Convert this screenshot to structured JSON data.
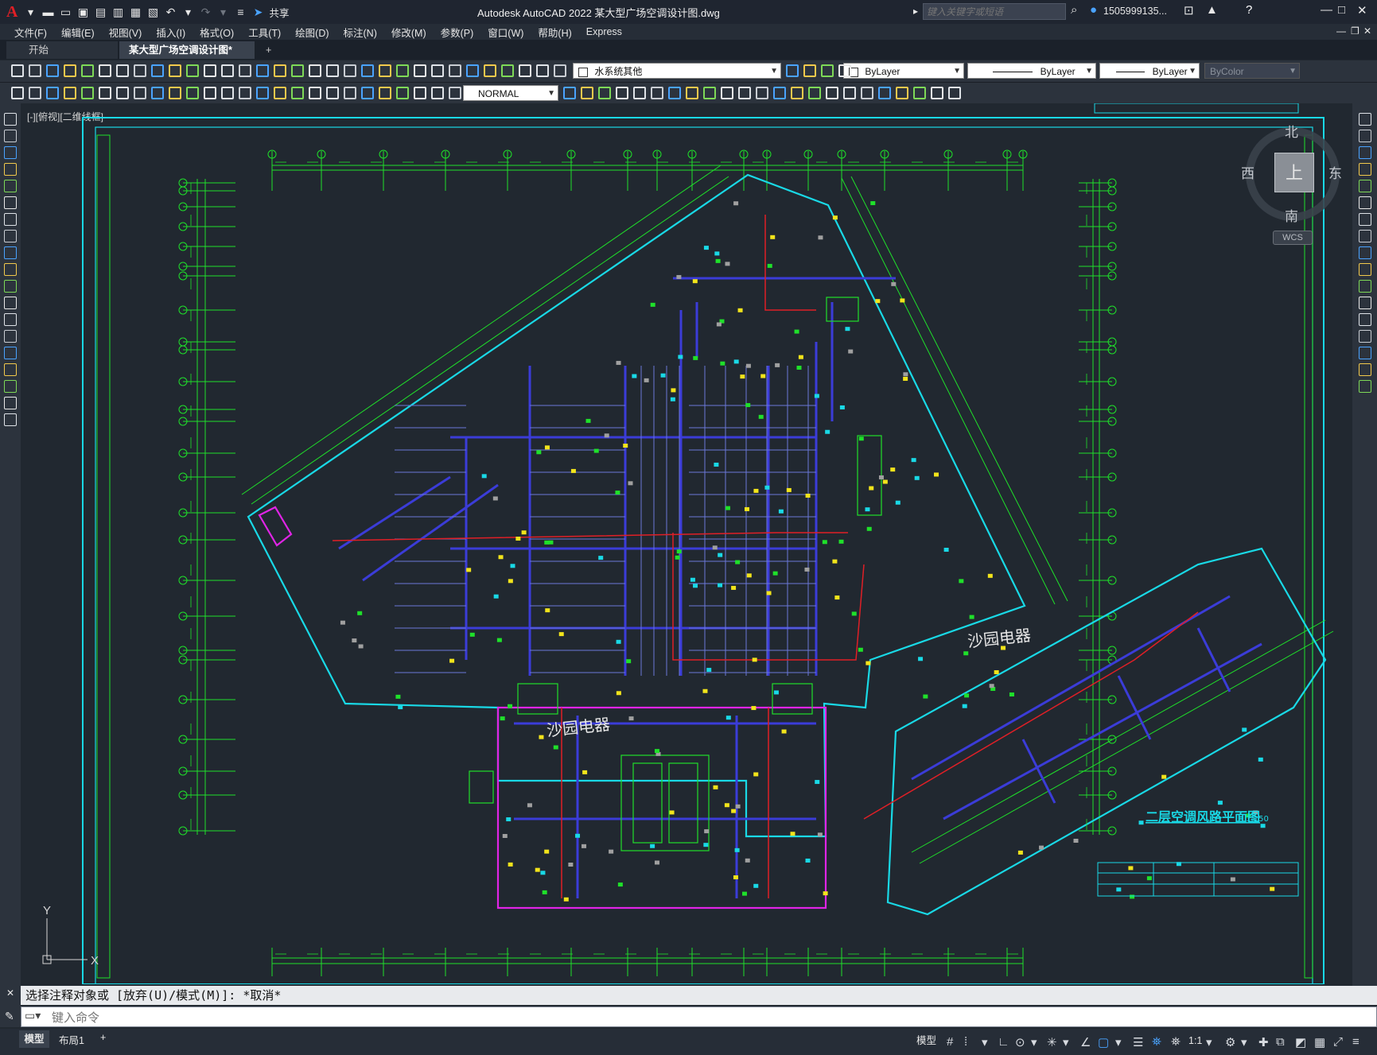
{
  "app": {
    "logo": "A",
    "title": "Autodesk AutoCAD 2022    某大型广场空调设计图.dwg",
    "share_label": "共享",
    "search_placeholder": "键入关键字或短语",
    "user_name": "1505999135..."
  },
  "menu": {
    "items": [
      "文件(F)",
      "编辑(E)",
      "视图(V)",
      "插入(I)",
      "格式(O)",
      "工具(T)",
      "绘图(D)",
      "标注(N)",
      "修改(M)",
      "参数(P)",
      "窗口(W)",
      "帮助(H)",
      "Express"
    ]
  },
  "tabs": {
    "start_label": "开始",
    "active_label": "某大型广场空调设计图*",
    "close_glyph": "×",
    "add_glyph": "+"
  },
  "toolbar": {
    "layer_name": "水系统其他",
    "color_value": "ByLayer",
    "linetype_value": "ByLayer",
    "lineweight_value": "ByLayer",
    "plotstyle_value": "ByColor",
    "dimstyle_value": "NORMAL"
  },
  "viewport": {
    "label": "[-][俯视][二维线框]"
  },
  "viewcube": {
    "north": "北",
    "south": "南",
    "east": "东",
    "west": "西",
    "top": "上",
    "wcs_label": "WCS"
  },
  "drawing": {
    "store_label_1": "沙园电器",
    "store_label_2": "沙园电器",
    "plan_title": "二层空调风路平面图",
    "plan_scale": "1:150",
    "ucs_y": "Y",
    "ucs_x": "X"
  },
  "command": {
    "history_text": "选择注释对象或 [放弃(U)/模式(M)]: *取消*",
    "input_placeholder": "键入命令"
  },
  "status": {
    "model_tab": "模型",
    "layout_tab": "布局1",
    "add_glyph": "+",
    "model_space_label": "模型",
    "annotation_scale": "1:1"
  },
  "colors": {
    "background": "#212830",
    "accent_cyan": "#19d9e6",
    "accent_green": "#1fe02a",
    "accent_magenta": "#e024e6",
    "accent_blue": "#3b3cd8",
    "accent_red": "#e01f26",
    "accent_yellow": "#f2e41b"
  }
}
